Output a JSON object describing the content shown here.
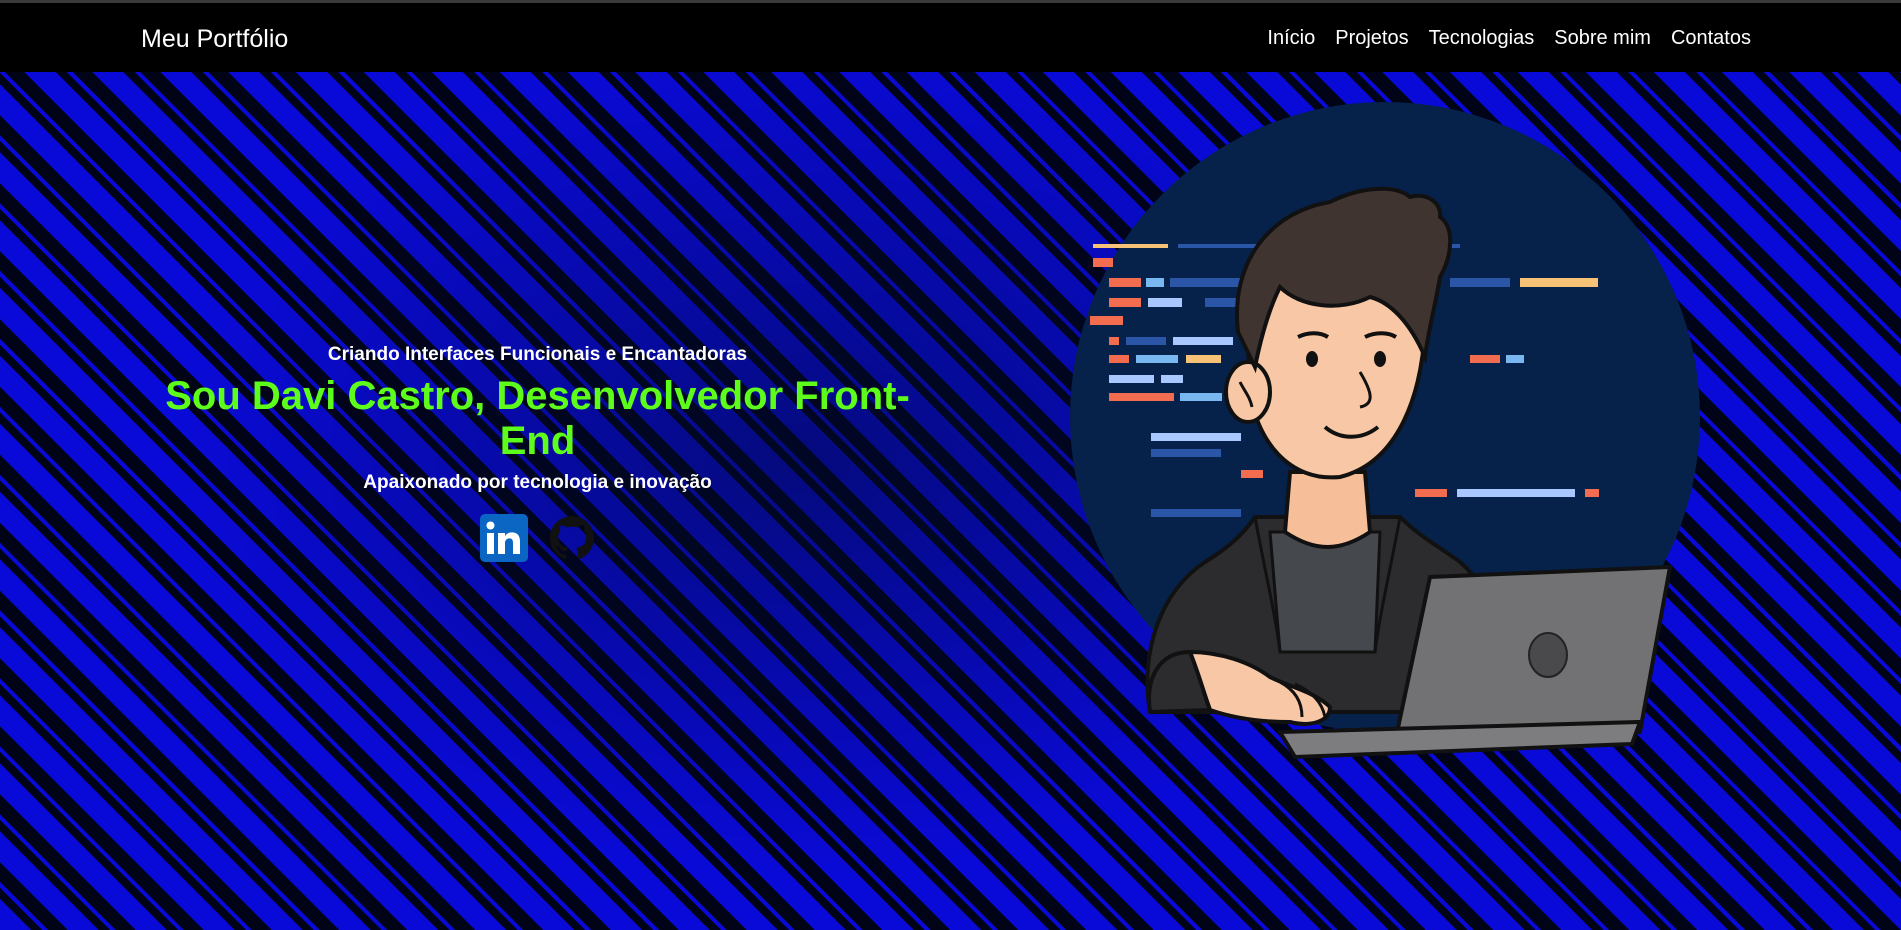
{
  "navbar": {
    "brand": "Meu Portfólio",
    "links": [
      "Início",
      "Projetos",
      "Tecnologias",
      "Sobre mim",
      "Contatos"
    ]
  },
  "hero": {
    "tagline": "Criando Interfaces Funcionais e Encantadoras",
    "headline": "Sou Davi Castro, Desenvolvedor Front-End",
    "subtitle": "Apaixonado por tecnologia e inovação",
    "social_icons": [
      "linkedin-icon",
      "github-icon"
    ]
  },
  "colors": {
    "headline": "#5dfc1a",
    "stripe_blue": "#0a0ad8",
    "stripe_dark": "#010316",
    "navbar_bg": "#000000",
    "circle_bg": "#06214a",
    "linkedin_blue": "#0a66c2"
  }
}
